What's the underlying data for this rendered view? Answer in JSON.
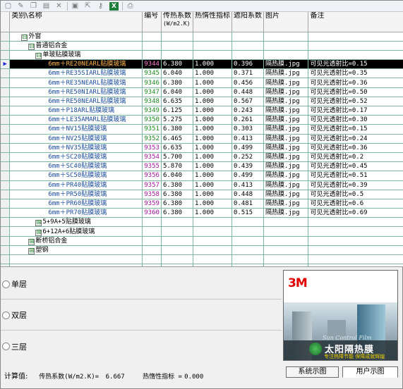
{
  "toolbar": {
    "icons": [
      "new-icon",
      "edit-icon",
      "copy-icon",
      "paste-icon",
      "delete-icon",
      "save-icon",
      "export-icon",
      "key-icon",
      "excel-icon",
      "print-icon"
    ],
    "excel_label": "X"
  },
  "grid": {
    "headers": {
      "name": "类别\\名称",
      "code": "编号",
      "u": "传热系数",
      "u_unit": "(W/m2.K)",
      "inertia": "热惰性指标",
      "shade": "遮阳系数",
      "pic": "图片",
      "note": "备注"
    },
    "tree": {
      "waichuang": "外窗",
      "putong": "普通铝合金",
      "danbo": "单玻贴膜玻璃",
      "g59": "5+9A+5贴膜玻璃",
      "g612": "6+12A+6贴膜玻璃",
      "duanqiao": "断桥铝合金",
      "suliao": "塑钢"
    },
    "rows": [
      {
        "name": "6mm＋RE20NEARL贴膜玻璃",
        "code": "9344",
        "u": "6.380",
        "inertia": "1.000",
        "shade": "0.396",
        "pic": "隔热膜.jpg",
        "note": "可见光透射比=0.15"
      },
      {
        "name": "6mm＋RE35SIARL贴膜玻璃",
        "code": "9345",
        "u": "6.040",
        "inertia": "1.000",
        "shade": "0.371",
        "pic": "隔热膜.jpg",
        "note": "可见光透射比=0.35"
      },
      {
        "name": "6mm＋RE35NEARL贴膜玻璃",
        "code": "9346",
        "u": "6.380",
        "inertia": "1.000",
        "shade": "0.456",
        "pic": "隔热膜.jpg",
        "note": "可见光透射比=0.36"
      },
      {
        "name": "6mm＋RE50NIARL贴膜玻璃",
        "code": "9347",
        "u": "6.040",
        "inertia": "1.000",
        "shade": "0.448",
        "pic": "隔热膜.jpg",
        "note": "可见光透射比=0.50"
      },
      {
        "name": "6mm＋RE50NEARL贴膜玻璃",
        "code": "9348",
        "u": "6.635",
        "inertia": "1.000",
        "shade": "0.567",
        "pic": "隔热膜.jpg",
        "note": "可见光透射比=0.52"
      },
      {
        "name": "6mm＋P18ARL贴膜玻璃",
        "code": "9349",
        "u": "6.125",
        "inertia": "1.000",
        "shade": "0.243",
        "pic": "隔热膜.jpg",
        "note": "可见光透射比=0.17"
      },
      {
        "name": "6mm＋LE35AMARL贴膜玻璃",
        "code": "9350",
        "u": "5.275",
        "inertia": "1.000",
        "shade": "0.261",
        "pic": "隔热膜.jpg",
        "note": "可见光透射比=0.30"
      },
      {
        "name": "6mm＋NV15贴膜玻璃",
        "code": "9351",
        "u": "6.380",
        "inertia": "1.000",
        "shade": "0.303",
        "pic": "隔热膜.jpg",
        "note": "可见光透射比=0.15"
      },
      {
        "name": "6mm＋NV25贴膜玻璃",
        "code": "9352",
        "u": "6.465",
        "inertia": "1.000",
        "shade": "0.413",
        "pic": "隔热膜.jpg",
        "note": "可见光透射比=0.24"
      },
      {
        "name": "6mm＋NV35贴膜玻璃",
        "code": "9353",
        "u": "6.635",
        "inertia": "1.000",
        "shade": "0.499",
        "pic": "隔热膜.jpg",
        "note": "可见光透射比=0.36"
      },
      {
        "name": "6mm＋SC20贴膜玻璃",
        "code": "9354",
        "u": "5.700",
        "inertia": "1.000",
        "shade": "0.252",
        "pic": "隔热膜.jpg",
        "note": "可见光透射比=0.2"
      },
      {
        "name": "6mm＋SC40贴膜玻璃",
        "code": "9355",
        "u": "5.870",
        "inertia": "1.000",
        "shade": "0.439",
        "pic": "隔热膜.jpg",
        "note": "可见光透射比=0.45"
      },
      {
        "name": "6mm＋SC50贴膜玻璃",
        "code": "9356",
        "u": "6.040",
        "inertia": "1.000",
        "shade": "0.499",
        "pic": "隔热膜.jpg",
        "note": "可见光透射比=0.51"
      },
      {
        "name": "6mm＋PR40贴膜玻璃",
        "code": "9357",
        "u": "6.380",
        "inertia": "1.000",
        "shade": "0.413",
        "pic": "隔热膜.jpg",
        "note": "可见光透射比=0.39"
      },
      {
        "name": "6mm＋PR50贴膜玻璃",
        "code": "9358",
        "u": "6.380",
        "inertia": "1.000",
        "shade": "0.448",
        "pic": "隔热膜.jpg",
        "note": "可见光透射比=0.5"
      },
      {
        "name": "6mm＋PR60贴膜玻璃",
        "code": "9359",
        "u": "6.380",
        "inertia": "1.000",
        "shade": "0.481",
        "pic": "隔热膜.jpg",
        "note": "可见光透射比=0.6"
      },
      {
        "name": "6mm＋PR70贴膜玻璃",
        "code": "9360",
        "u": "6.380",
        "inertia": "1.000",
        "shade": "0.515",
        "pic": "隔热膜.jpg",
        "note": "可见光透射比=0.69"
      }
    ],
    "selected_index": 0,
    "expanded": "⊟",
    "collapsed": "⊞",
    "row_marker": "▶"
  },
  "options": {
    "single": "单层",
    "double": "双层",
    "triple": "三层"
  },
  "ad": {
    "logo": "3M",
    "sub": "Sun Control Film",
    "title": "太阳隔热膜",
    "slogan": "专注热障节能 保障成就辉煌"
  },
  "footer": {
    "calc_label": "计算值:",
    "u_label": "传热系数(W/m2.K)=",
    "u_value": "6.667",
    "inertia_label": "热惰性指标 =",
    "inertia_value": "0.000",
    "btn_system": "系统示图",
    "btn_user": "用户示图"
  }
}
